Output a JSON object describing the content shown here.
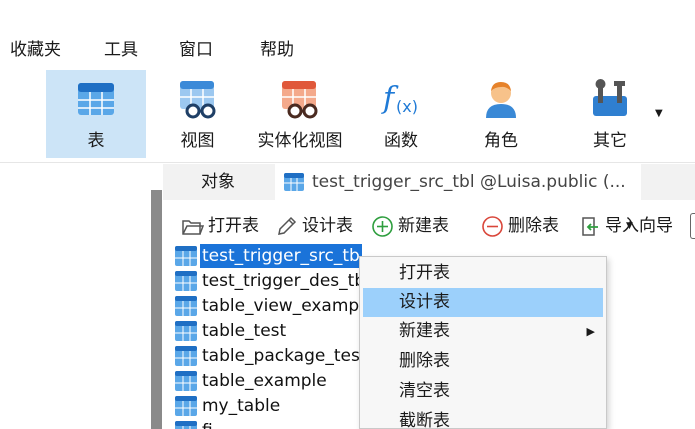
{
  "menubar": {
    "items": [
      "收藏夹",
      "工具",
      "窗口",
      "帮助"
    ]
  },
  "toolbar": {
    "buttons": [
      {
        "label": "表",
        "icon": "table-icon",
        "selected": true
      },
      {
        "label": "视图",
        "icon": "view-icon",
        "selected": false
      },
      {
        "label": "实体化视图",
        "icon": "materialized-view-icon",
        "selected": false
      },
      {
        "label": "函数",
        "icon": "function-icon",
        "selected": false
      },
      {
        "label": "角色",
        "icon": "role-icon",
        "selected": false
      },
      {
        "label": "其它",
        "icon": "tools-icon",
        "selected": false
      }
    ],
    "overflow_glyph": "▼"
  },
  "tabs": {
    "objects_label": "对象",
    "table_tab_label": "test_trigger_src_tbl @Luisa.public (..."
  },
  "object_toolbar": {
    "open": "打开表",
    "design": "设计表",
    "new": "新建表",
    "delete": "删除表",
    "import": "导入向导",
    "caret": "▼"
  },
  "table_list": {
    "items": [
      {
        "label": "test_trigger_src_tb",
        "selected": true
      },
      {
        "label": "test_trigger_des_tb",
        "selected": false
      },
      {
        "label": "table_view_examp",
        "selected": false
      },
      {
        "label": "table_test",
        "selected": false
      },
      {
        "label": "table_package_tes",
        "selected": false
      },
      {
        "label": "table_example",
        "selected": false
      },
      {
        "label": "my_table",
        "selected": false
      },
      {
        "label": "fi",
        "selected": false
      }
    ]
  },
  "context_menu": {
    "items": [
      {
        "label": "打开表",
        "highlight": false,
        "submenu": false
      },
      {
        "label": "设计表",
        "highlight": true,
        "submenu": false
      },
      {
        "label": "新建表",
        "highlight": false,
        "submenu": true
      },
      {
        "label": "删除表",
        "highlight": false,
        "submenu": false
      },
      {
        "label": "清空表",
        "highlight": false,
        "submenu": false
      },
      {
        "label": "截断表",
        "highlight": false,
        "submenu": false
      }
    ],
    "submenu_arrow": "▶"
  },
  "colors": {
    "accent": "#1a73d9",
    "selected_toolbar_bg": "#cce4f7",
    "context_highlight": "#9cd0fb"
  }
}
